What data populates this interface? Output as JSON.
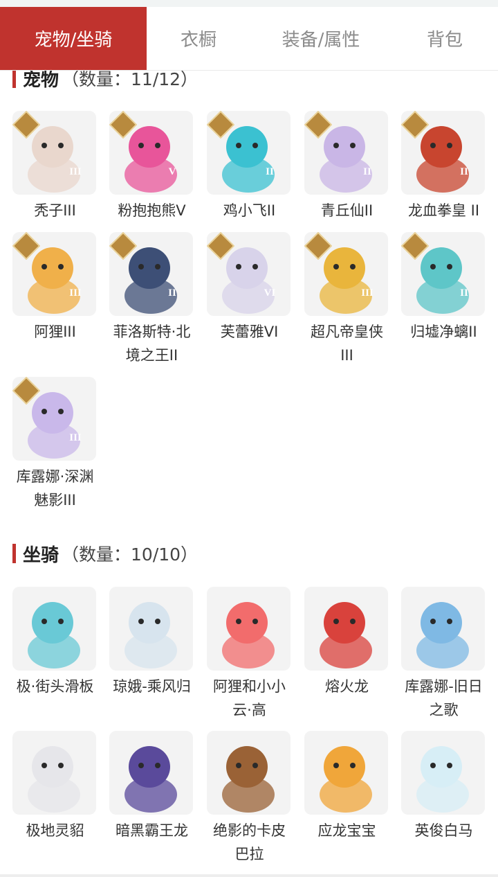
{
  "tabs": [
    {
      "label": "宠物/坐骑",
      "active": true
    },
    {
      "label": "衣橱",
      "active": false
    },
    {
      "label": "装备/属性",
      "active": false
    },
    {
      "label": "背包",
      "active": false
    }
  ],
  "pets": {
    "title": "宠物",
    "count": "（数量：11/12）",
    "items": [
      {
        "name": "秃子III",
        "rank": "III",
        "icon": "bald-head-icon",
        "color": "#e9d7cd"
      },
      {
        "name": "粉抱抱熊Ⅴ",
        "rank": "V",
        "icon": "pink-bear-icon",
        "color": "#e8559a"
      },
      {
        "name": "鸡小飞II",
        "rank": "II",
        "icon": "chick-icon",
        "color": "#3bc1d1"
      },
      {
        "name": "青丘仙II",
        "rank": "II",
        "icon": "fox-fairy-icon",
        "color": "#c9b6e6"
      },
      {
        "name": "龙血拳皇 II",
        "rank": "II",
        "icon": "dragon-fist-icon",
        "color": "#c8452f"
      },
      {
        "name": "阿狸III",
        "rank": "III",
        "icon": "ali-fox-icon",
        "color": "#f0b04a"
      },
      {
        "name": "菲洛斯特·北境之王II",
        "rank": "II",
        "icon": "frost-king-icon",
        "color": "#3d4f76"
      },
      {
        "name": "芙蕾雅VI",
        "rank": "VI",
        "icon": "freya-icon",
        "color": "#d8d3ea"
      },
      {
        "name": "超凡帝皇侠III",
        "rank": "III",
        "icon": "golden-armor-icon",
        "color": "#e9b53c"
      },
      {
        "name": "归墟净螭II",
        "rank": "II",
        "icon": "water-dragon-icon",
        "color": "#5ec6c8"
      },
      {
        "name": "库露娜·深渊魅影III",
        "rank": "III",
        "icon": "kuluna-icon",
        "color": "#c9b8ea"
      }
    ]
  },
  "mounts": {
    "title": "坐骑",
    "count": "（数量：10/10）",
    "items": [
      {
        "name": "极·街头滑板",
        "icon": "skateboard-icon",
        "color": "#69c9d6"
      },
      {
        "name": "琼娥-乘风归",
        "icon": "moon-fairy-icon",
        "color": "#d7e4ee"
      },
      {
        "name": "阿狸和小小云·高",
        "icon": "ali-cloud-icon",
        "color": "#f26c6c"
      },
      {
        "name": "熔火龙",
        "icon": "lava-dragon-icon",
        "color": "#d9423c"
      },
      {
        "name": "库露娜-旧日之歌",
        "icon": "kuluna-song-icon",
        "color": "#7fb9e4"
      },
      {
        "name": "极地灵貂",
        "icon": "polar-mink-icon",
        "color": "#e6e6ea"
      },
      {
        "name": "暗黑霸王龙",
        "icon": "dark-trex-icon",
        "color": "#5a4a9b"
      },
      {
        "name": "绝影的卡皮巴拉",
        "icon": "capybara-icon",
        "color": "#9a6236"
      },
      {
        "name": "应龙宝宝",
        "icon": "baby-dragon-icon",
        "color": "#f0a63a"
      },
      {
        "name": "英俊白马",
        "icon": "white-horse-icon",
        "color": "#d7eef6"
      }
    ]
  },
  "colors": {
    "accent": "#c0332e",
    "rank_badge": "#b88a3e"
  }
}
